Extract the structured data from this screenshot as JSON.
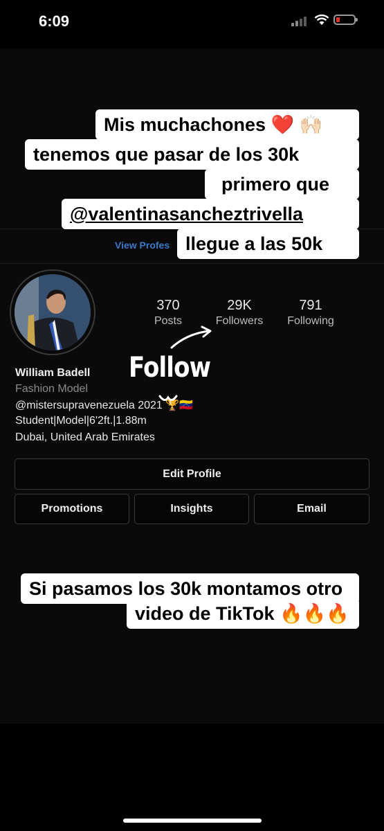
{
  "status": {
    "time": "6:09"
  },
  "background": {
    "view_profile": "View Profes"
  },
  "story": {
    "top_lines": [
      "Mis muchachones ❤️ 🙌🏻",
      "tenemos que pasar de los 30k",
      "primero que",
      "@valentinasancheztrivella",
      "llegue a las 50k"
    ],
    "bottom_lines": [
      "Si pasamos los 30k montamos otro",
      "video de TikTok 🔥🔥🔥"
    ],
    "follow_annotation": "Follow"
  },
  "profile": {
    "name": "William Badell",
    "category": "Fashion Model",
    "bio": [
      "@mistersupravenezuela 2021 🏆🇻🇪",
      "Student|Model|6'2ft.|1.88m",
      "Dubai, United Arab Emirates"
    ],
    "stats": [
      {
        "value": "370",
        "label": "Posts"
      },
      {
        "value": "29K",
        "label": "Followers"
      },
      {
        "value": "791",
        "label": "Following"
      }
    ],
    "buttons": {
      "edit": "Edit Profile",
      "promotions": "Promotions",
      "insights": "Insights",
      "email": "Email"
    }
  }
}
